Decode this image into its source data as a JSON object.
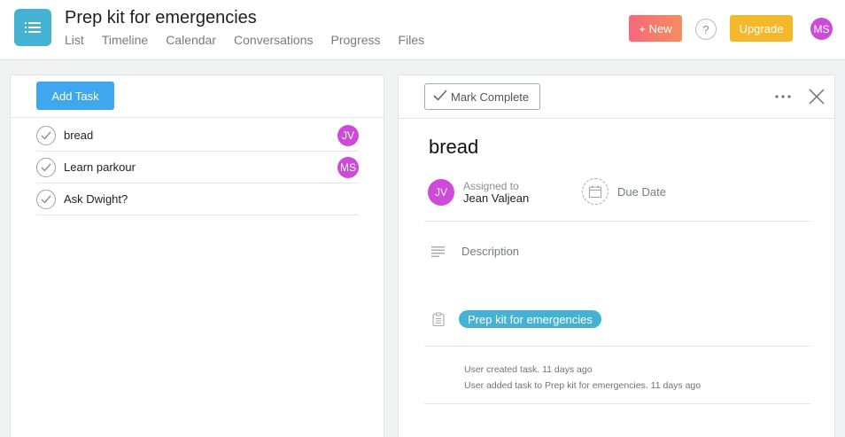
{
  "header": {
    "project_title": "Prep kit for emergencies",
    "nav": [
      "List",
      "Timeline",
      "Calendar",
      "Conversations",
      "Progress",
      "Files"
    ],
    "new_button": "+ New",
    "help_button": "?",
    "upgrade_button": "Upgrade",
    "user_initials": "MS",
    "app_icon": "list-icon"
  },
  "left_panel": {
    "add_task_button": "Add Task",
    "tasks": [
      {
        "name": "bread",
        "assignee": "JV"
      },
      {
        "name": "Learn parkour",
        "assignee": "MS"
      },
      {
        "name": "Ask Dwight?",
        "assignee": ""
      }
    ]
  },
  "detail": {
    "mark_complete_button": "Mark Complete",
    "title": "bread",
    "assigned_label": "Assigned to",
    "assignee_initials": "JV",
    "assignee_name": "Jean Valjean",
    "due_date_label": "Due Date",
    "description_placeholder": "Description",
    "project_tag": "Prep kit for emergencies",
    "activity": [
      "User created task. 11 days ago",
      "User added task to Prep kit for emergencies. 11 days ago"
    ]
  },
  "colors": {
    "accent": "#46b2d3",
    "avatar": "#cc4bd9",
    "add_task": "#3fa7f0",
    "upgrade": "#f5b82a",
    "new_gradient_start": "#f7697a",
    "new_gradient_end": "#f78c5f"
  }
}
